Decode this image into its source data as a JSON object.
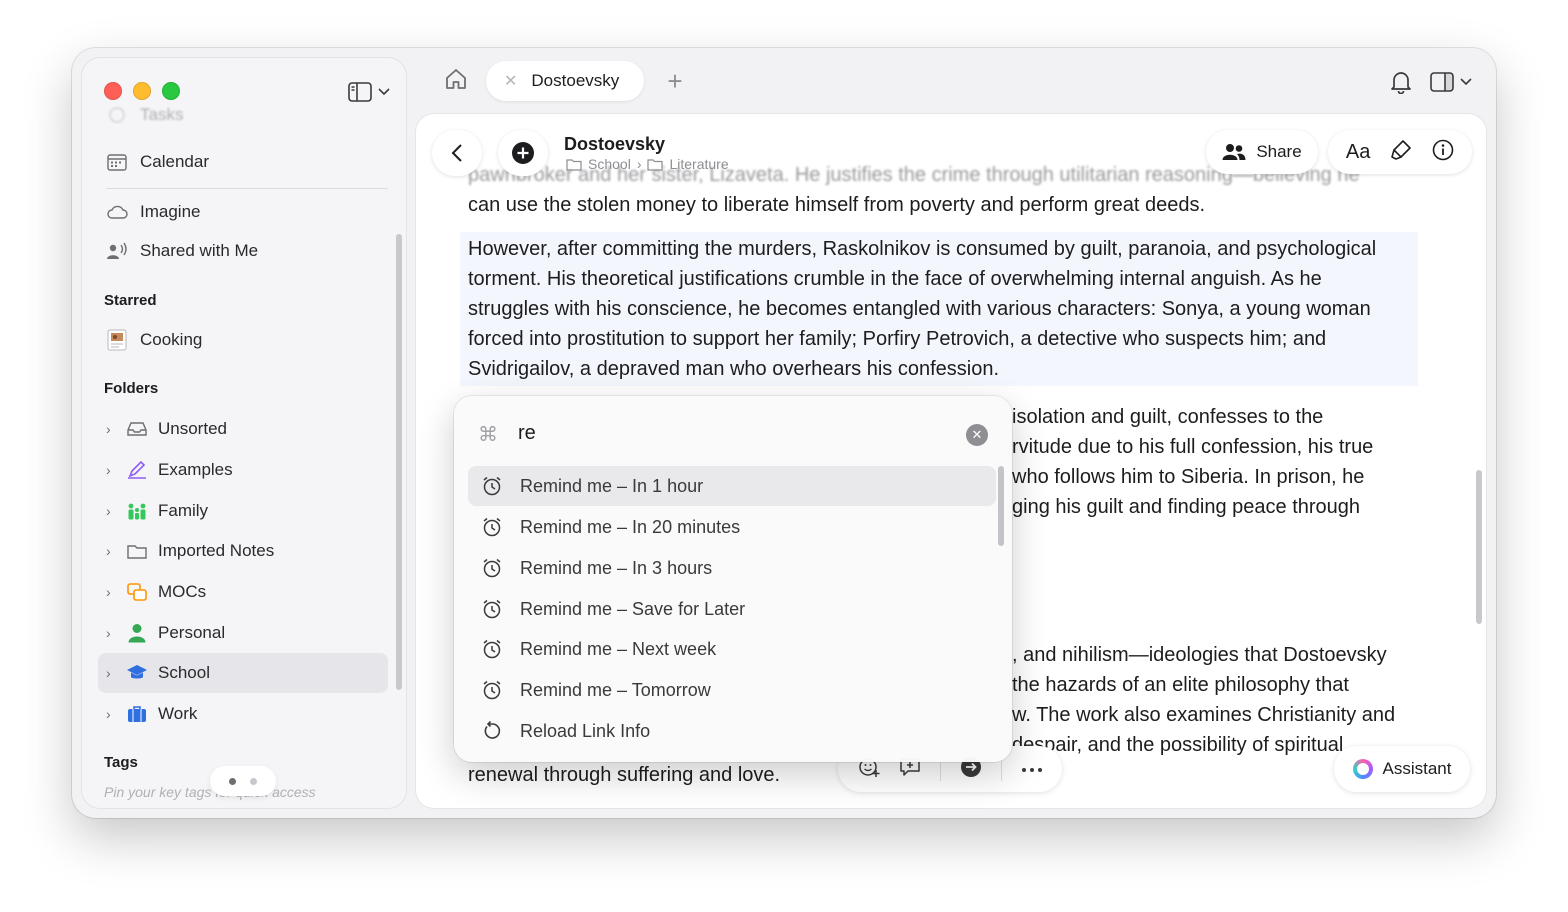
{
  "sidebar": {
    "partial_top_item": "Tasks",
    "nav": [
      {
        "label": "Calendar",
        "icon": "calendar-icon"
      },
      {
        "label": "Imagine",
        "icon": "cloud-icon"
      },
      {
        "label": "Shared with Me",
        "icon": "shared-person-icon"
      }
    ],
    "starred_heading": "Starred",
    "starred": [
      {
        "label": "Cooking",
        "icon": "cooking-thumbnail-icon"
      }
    ],
    "folders_heading": "Folders",
    "folders": [
      {
        "label": "Unsorted",
        "icon": "tray-icon",
        "color": "#8e8e93"
      },
      {
        "label": "Examples",
        "icon": "pen-icon",
        "color": "#8e5cf7"
      },
      {
        "label": "Family",
        "icon": "family-icon",
        "color": "#34c759"
      },
      {
        "label": "Imported Notes",
        "icon": "folder-icon",
        "color": "#8e8e93"
      },
      {
        "label": "MOCs",
        "icon": "mocs-icon",
        "color": "#ff9500"
      },
      {
        "label": "Personal",
        "icon": "person-icon",
        "color": "#34a853"
      },
      {
        "label": "School",
        "icon": "graduation-cap-icon",
        "color": "#2f6fe0",
        "selected": true
      },
      {
        "label": "Work",
        "icon": "briefcase-icon",
        "color": "#2f6fe0"
      }
    ],
    "tags_heading": "Tags",
    "tags_hint": "Pin your key tags for quick access",
    "pager_active": 0
  },
  "topbar": {
    "tab_title": "Dostoevsky",
    "add_tab_label": "+"
  },
  "document": {
    "title": "Dostoevsky",
    "breadcrumb": [
      "School",
      "Literature"
    ],
    "share_label": "Share",
    "font_button": "Aa",
    "assistant_label": "Assistant",
    "paragraphs": [
      "pawnbroker and her sister, Lizaveta. He justifies the crime through utilitarian reasoning—believing he",
      "can use the stolen money to liberate himself from poverty and perform great deeds.",
      "However, after committing the murders, Raskolnikov is consumed by guilt, paranoia, and psychological torment. His theoretical justifications crumble in the face of overwhelming internal anguish. As he struggles with his conscience, he becomes entangled with various characters: Sonya, a young woman forced into prostitution to support her family; Porfiry Petrovich, a detective who suspects him; and Svidrigailov, a depraved man who overhears his confession.",
      "isolation and guilt, confesses to the",
      "rvitude due to his full confession, his true",
      "who follows him to Siberia. In prison, he",
      "ging his guilt and finding peace through",
      ", and nihilism—ideologies that Dostoevsky",
      "the hazards of an elite philosophy that",
      "w. The work also examines Christianity and",
      "despair, and the possibility of spiritual",
      "renewal through suffering and love."
    ]
  },
  "palette": {
    "query": "re",
    "items": [
      {
        "label": "Remind me – In 1 hour",
        "icon": "alarm-clock-icon",
        "active": true
      },
      {
        "label": "Remind me – In 20 minutes",
        "icon": "alarm-clock-icon"
      },
      {
        "label": "Remind me – In 3 hours",
        "icon": "alarm-clock-icon"
      },
      {
        "label": "Remind me – Save for Later",
        "icon": "alarm-clock-icon"
      },
      {
        "label": "Remind me – Next week",
        "icon": "alarm-clock-icon"
      },
      {
        "label": "Remind me – Tomorrow",
        "icon": "alarm-clock-icon"
      },
      {
        "label": "Reload Link Info",
        "icon": "reload-icon"
      }
    ]
  },
  "colors": {
    "window_bg": "#f2f2f4",
    "selected_row": "#e6e6ea",
    "highlight_paragraph": "#f3f6fc",
    "accent_blue": "#2f6fe0"
  }
}
